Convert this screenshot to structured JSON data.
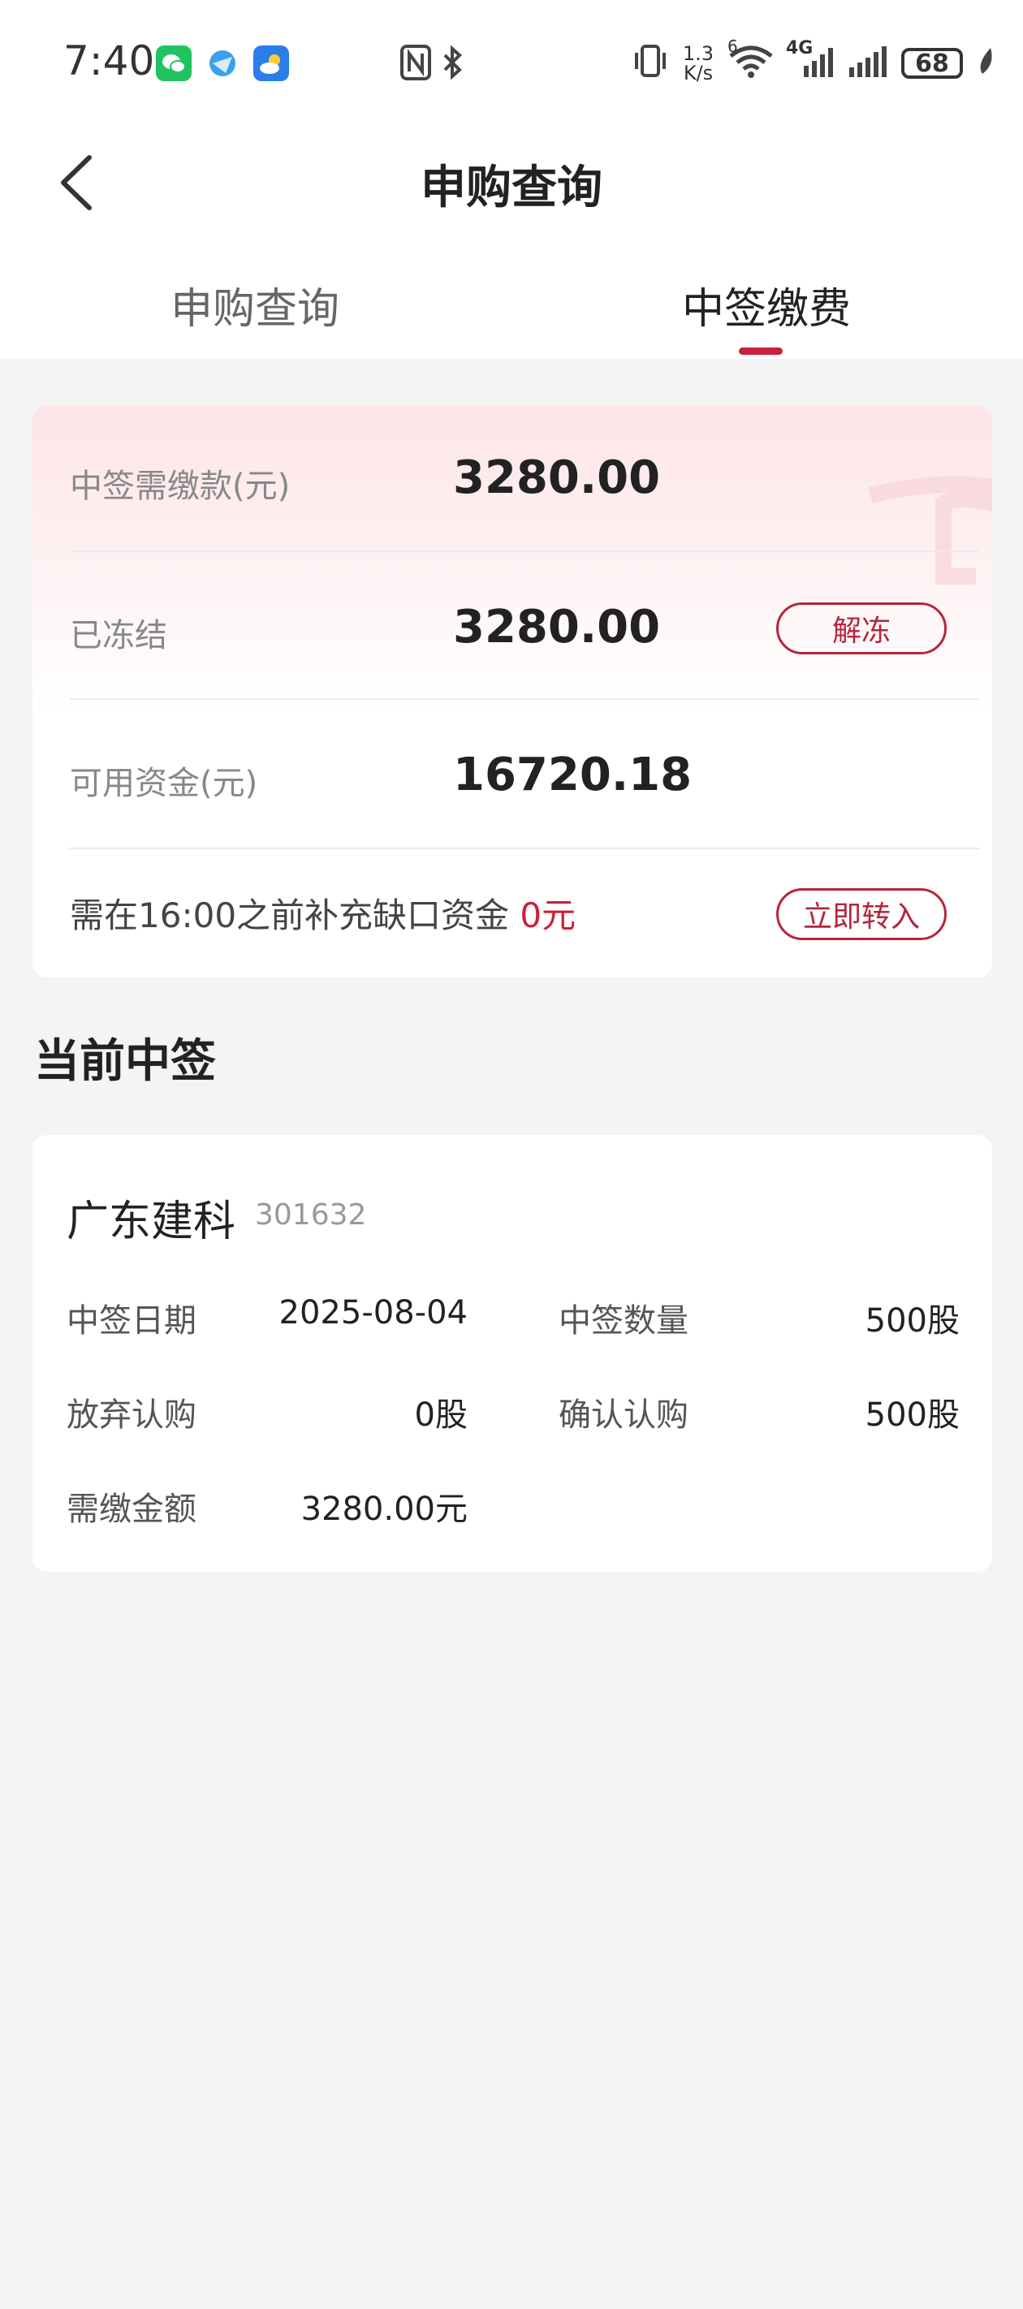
{
  "status_bar": {
    "time": "7:40",
    "net_speed": "1.3 K/s",
    "wifi_label": "6",
    "cell_label": "4G",
    "battery": "68",
    "icons": [
      "wechat-icon",
      "browser-icon",
      "weather-icon",
      "nfc-icon",
      "bluetooth-icon",
      "vibrate-icon",
      "wifi-icon",
      "signal-icon",
      "battery-icon",
      "leaf-icon"
    ]
  },
  "header": {
    "title": "申购查询",
    "tabs": [
      {
        "label": "申购查询",
        "active": false
      },
      {
        "label": "中签缴费",
        "active": true
      }
    ]
  },
  "summary": {
    "rows": [
      {
        "label": "中签需缴款(元)",
        "value": "3280.00"
      },
      {
        "label": "已冻结",
        "value": "3280.00",
        "button": "解冻"
      },
      {
        "label": "可用资金(元)",
        "value": "16720.18"
      }
    ],
    "notice_text": "需在16:00之前补充缺口资金",
    "notice_amount": "0元",
    "transfer_button": "立即转入"
  },
  "section_title": "当前中签",
  "stock": {
    "name": "广东建科",
    "code": "301632",
    "fields": {
      "date_label": "中签日期",
      "date_value": "2025-08-04",
      "qty_label": "中签数量",
      "qty_value": "500股",
      "abandon_label": "放弃认购",
      "abandon_value": "0股",
      "confirm_label": "确认认购",
      "confirm_value": "500股",
      "amount_label": "需缴金额",
      "amount_value": "3280.00元"
    }
  },
  "colors": {
    "accent": "#c8213c",
    "background": "#f4f4f4"
  }
}
